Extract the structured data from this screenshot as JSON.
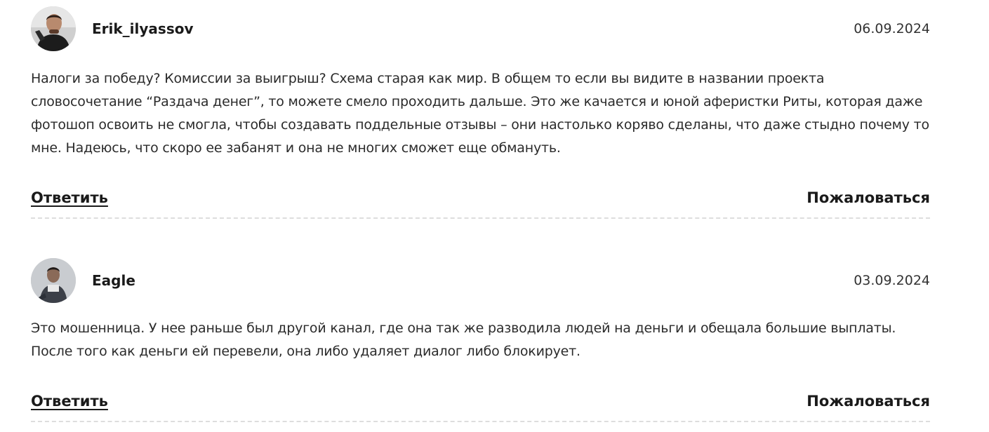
{
  "comments": [
    {
      "author": "Erik_ilyassov",
      "date": "06.09.2024",
      "avatar_icon": "user-avatar-photo",
      "text": "Налоги за победу? Комиссии за выигрыш? Схема старая как мир. В общем то если вы видите в названии проекта словосочетание “Раздача денег”, то можете смело проходить дальше. Это же качается и юной аферистки Риты, которая даже фотошоп освоить не смогла, чтобы создавать поддельные отзывы – они настолько коряво сделаны, что даже стыдно почему то мне. Надеюсь, что скоро ее забанят и она не многих сможет еще обмануть.",
      "reply_label": "Ответить",
      "report_label": "Пожаловаться"
    },
    {
      "author": "Eagle",
      "date": "03.09.2024",
      "avatar_icon": "user-avatar-photo",
      "text": "Это мошенница. У нее раньше был другой канал, где она так же разводила людей на деньги и обещала большие выплаты. После того как деньги ей перевели, она либо удаляет диалог либо блокирует.",
      "reply_label": "Ответить",
      "report_label": "Пожаловаться"
    }
  ],
  "colors": {
    "text": "#2b2b2b",
    "divider": "#dddddd",
    "background": "#ffffff"
  }
}
